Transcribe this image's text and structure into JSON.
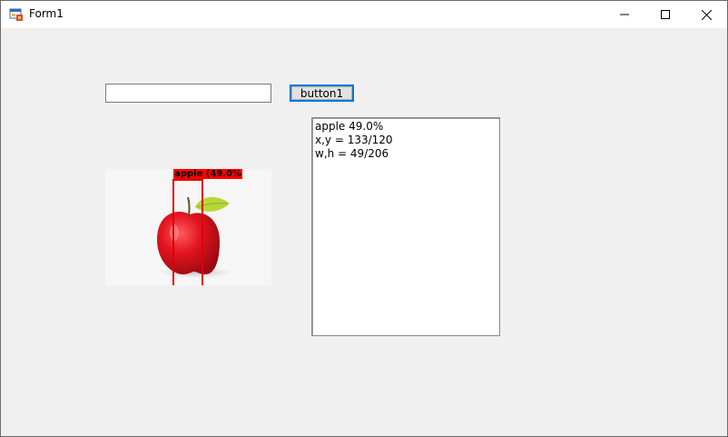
{
  "window": {
    "title": "Form1",
    "controls": {
      "minimize": "minimize-icon",
      "maximize": "maximize-icon",
      "close": "close-icon"
    }
  },
  "form": {
    "textbox": {
      "value": "",
      "placeholder": ""
    },
    "button1_label": "button1"
  },
  "picture": {
    "subject": "apple",
    "detection_label": "apple (49.0%)",
    "box_color": "#ff0000"
  },
  "listbox": {
    "lines": [
      "apple 49.0%",
      "x,y = 133/120",
      "w,h = 49/206"
    ]
  },
  "colors": {
    "accent": "#0078d7",
    "form_bg": "#f0f0f0"
  }
}
